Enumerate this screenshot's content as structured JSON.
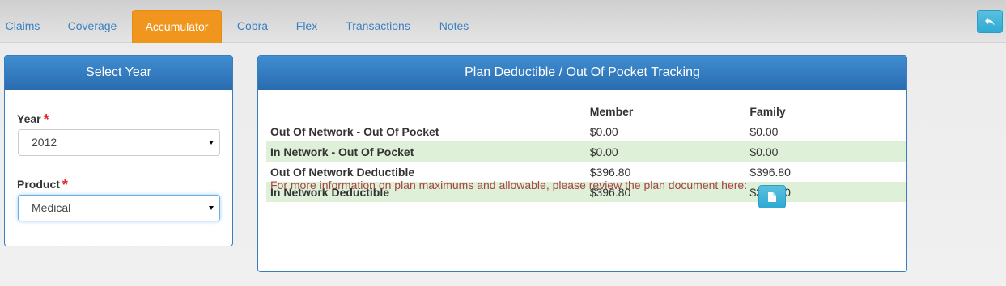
{
  "tabs": [
    {
      "label": "Claims"
    },
    {
      "label": "Coverage"
    },
    {
      "label": "Accumulator",
      "active": true
    },
    {
      "label": "Cobra"
    },
    {
      "label": "Flex"
    },
    {
      "label": "Transactions"
    },
    {
      "label": "Notes"
    }
  ],
  "back_button_icon": "reply-icon",
  "select_year": {
    "title": "Select Year",
    "year_label": "Year",
    "year_value": "2012",
    "product_label": "Product",
    "product_value": "Medical",
    "required_marker": "*"
  },
  "tracking": {
    "title": "Plan Deductible / Out Of Pocket Tracking",
    "columns": [
      "Member",
      "Family"
    ],
    "rows": [
      {
        "label": "Out Of Network - Out Of Pocket",
        "member": "$0.00",
        "family": "$0.00",
        "shaded": false
      },
      {
        "label": "In Network - Out Of Pocket",
        "member": "$0.00",
        "family": "$0.00",
        "shaded": true
      },
      {
        "label": "Out Of Network Deductible",
        "member": "$396.80",
        "family": "$396.80",
        "shaded": false
      },
      {
        "label": "In Network Deductible",
        "member": "$396.80",
        "family": "$396.80",
        "shaded": true
      }
    ],
    "info_text": "For more information on plan maximums and allowable, please review the plan document here:",
    "doc_button_icon": "file-icon"
  },
  "colors": {
    "active_tab": "#f0961e",
    "panel_header": "#2f77bd",
    "tab_link": "#3a80c2",
    "info_text": "#a94442",
    "shaded_row": "#dff0d8",
    "button": "#5bc0de"
  }
}
